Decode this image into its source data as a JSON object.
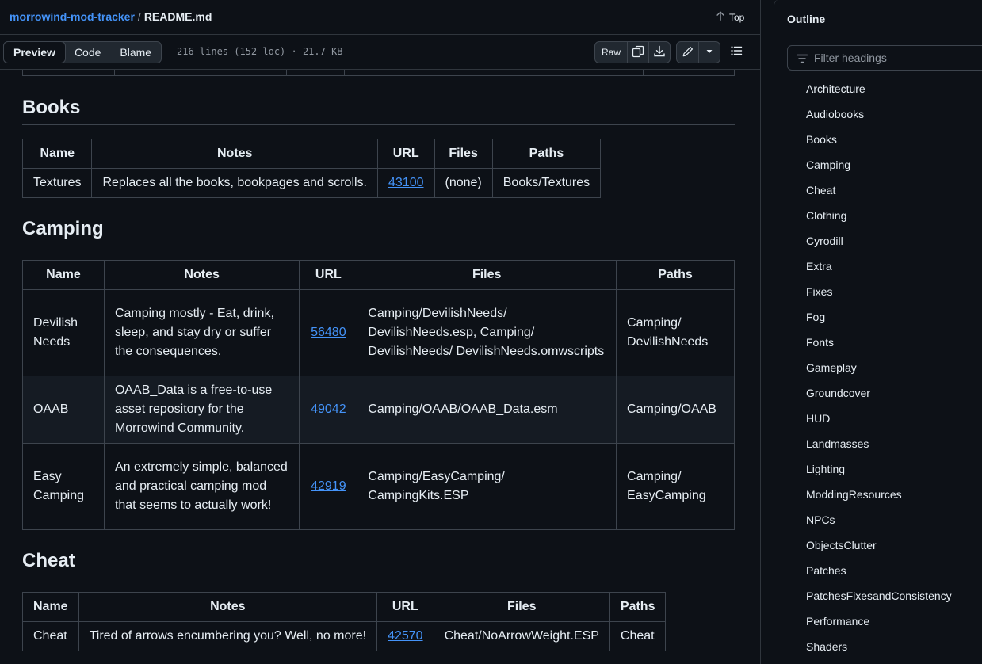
{
  "breadcrumb": {
    "repo": "morrowind-mod-tracker",
    "separator": "/",
    "file": "README.md"
  },
  "top_link": "Top",
  "view_tabs": [
    "Preview",
    "Code",
    "Blame"
  ],
  "file_meta": "216 lines (152 loc) · 21.7 KB",
  "toolbar": {
    "raw_label": "Raw"
  },
  "sections": {
    "books": {
      "title": "Books",
      "headers": [
        "Name",
        "Notes",
        "URL",
        "Files",
        "Paths"
      ],
      "rows": [
        [
          "Textures",
          "Replaces all the books, bookpages and scrolls.",
          "43100",
          "(none)",
          "Books/Textures"
        ]
      ]
    },
    "camping": {
      "title": "Camping",
      "headers": [
        "Name",
        "Notes",
        "URL",
        "Files",
        "Paths"
      ],
      "rows": [
        [
          "Devilish Needs",
          "Camping mostly - Eat, drink, sleep, and stay dry or suffer the consequences.",
          "56480",
          "Camping/DevilishNeeds/ DevilishNeeds.esp, Camping/ DevilishNeeds/ DevilishNeeds.omwscripts",
          "Camping/ DevilishNeeds"
        ],
        [
          "OAAB",
          "OAAB_Data is a free-to-use asset repository for the Morrowind Community.",
          "49042",
          "Camping/OAAB/OAAB_Data.esm",
          "Camping/OAAB"
        ],
        [
          "Easy Camping",
          "An extremely simple, balanced and practical camping mod that seems to actually work!",
          "42919",
          "Camping/EasyCamping/ CampingKits.ESP",
          "Camping/ EasyCamping"
        ]
      ]
    },
    "cheat": {
      "title": "Cheat",
      "headers": [
        "Name",
        "Notes",
        "URL",
        "Files",
        "Paths"
      ],
      "rows": [
        [
          "Cheat",
          "Tired of arrows encumbering you? Well, no more!",
          "42570",
          "Cheat/NoArrowWeight.ESP",
          "Cheat"
        ]
      ]
    }
  },
  "outline": {
    "title": "Outline",
    "filter_placeholder": "Filter headings",
    "items": [
      "Architecture",
      "Audiobooks",
      "Books",
      "Camping",
      "Cheat",
      "Clothing",
      "Cyrodill",
      "Extra",
      "Fixes",
      "Fog",
      "Fonts",
      "Gameplay",
      "Groundcover",
      "HUD",
      "Landmasses",
      "Lighting",
      "ModdingResources",
      "NPCs",
      "ObjectsClutter",
      "Patches",
      "PatchesFixesandConsistency",
      "Performance",
      "Shaders"
    ]
  },
  "colors": {
    "bg": "#0d1117",
    "link": "#4493f8",
    "border": "#3d444d",
    "text": "#e6edf3",
    "muted": "#9198a1",
    "row_alt": "#151b23"
  },
  "icons": [
    "arrow-up-icon",
    "copy-icon",
    "download-icon",
    "pencil-icon",
    "triangle-down-icon",
    "list-unordered-icon",
    "filter-icon"
  ]
}
